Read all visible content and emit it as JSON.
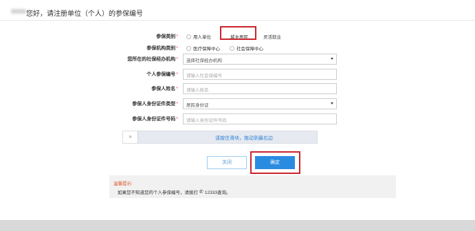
{
  "header": {
    "title": "您好，请注册单位（个人）的参保编号"
  },
  "form": {
    "insured_type": {
      "label": "参保类别",
      "required_mark": "*",
      "options": [
        "用人单位",
        "城乡居民",
        "灵活就业"
      ],
      "highlighted": "城乡居民"
    },
    "agency_type": {
      "label": "参保机构类别",
      "required_mark": "*",
      "options": [
        "医疗保障中心",
        "社会保障中心"
      ]
    },
    "agency": {
      "label": "您所在的社保经办机构",
      "required_mark": "*",
      "value": "选择社保经办机构"
    },
    "personal_number": {
      "label": "个人参保编号",
      "required_mark": "*",
      "placeholder": "请输入社会保编号"
    },
    "name": {
      "label": "参保人姓名",
      "required_mark": "*",
      "placeholder": "请输入姓名"
    },
    "id_type": {
      "label": "参保人身份证件类型",
      "required_mark": "*",
      "value": "居民身份证"
    },
    "id_number": {
      "label": "参保人身份证件号码",
      "required_mark": "*",
      "placeholder": "请输入身份证件号码"
    }
  },
  "slider": {
    "handle": "»",
    "text": "请按住滑块，拖动到最右边"
  },
  "buttons": {
    "close": "关闭",
    "ok": "确定"
  },
  "tip": {
    "title": "温馨提示:",
    "content_before": "如果您不知道您的个人参保编号，请拨打",
    "phone_icon": "phone-icon",
    "content_after": "12333查询。"
  },
  "colors": {
    "highlight": "#c8232b",
    "primary": "#2a8ce0",
    "tip_title": "#e0522a"
  }
}
